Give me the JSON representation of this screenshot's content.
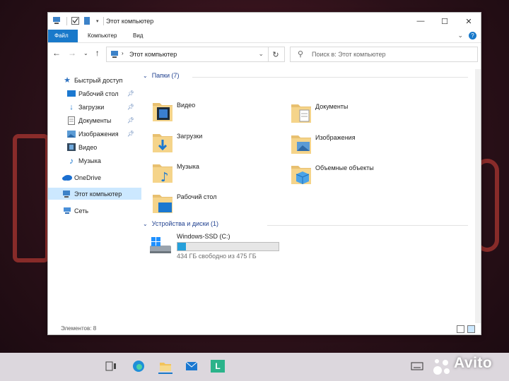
{
  "window": {
    "title": "Этот компьютер",
    "controls": {
      "minimize": "—",
      "maximize": "☐",
      "close": "✕"
    }
  },
  "ribbon": {
    "tabs": [
      "Файл",
      "Компьютер",
      "Вид"
    ],
    "expand_icon": "chevron-down-icon",
    "help_icon": "help-icon"
  },
  "address": {
    "path": "Этот компьютер",
    "search_placeholder": "Поиск в: Этот компьютер"
  },
  "sidebar": {
    "items": [
      {
        "label": "Быстрый доступ",
        "icon": "star-icon",
        "pinned": false
      },
      {
        "label": "Рабочий стол",
        "icon": "desktop-icon",
        "pinned": true
      },
      {
        "label": "Загрузки",
        "icon": "download-icon",
        "pinned": true
      },
      {
        "label": "Документы",
        "icon": "documents-icon",
        "pinned": true
      },
      {
        "label": "Изображения",
        "icon": "pictures-icon",
        "pinned": true
      },
      {
        "label": "Видео",
        "icon": "video-icon",
        "pinned": false
      },
      {
        "label": "Музыка",
        "icon": "music-icon",
        "pinned": false
      },
      {
        "label": "OneDrive",
        "icon": "cloud-icon",
        "pinned": false
      },
      {
        "label": "Этот компьютер",
        "icon": "computer-icon",
        "pinned": false,
        "selected": true
      },
      {
        "label": "Сеть",
        "icon": "network-icon",
        "pinned": false
      }
    ]
  },
  "content": {
    "folders_header": "Папки (7)",
    "folders": [
      {
        "label": "Видео",
        "icon": "video-folder-icon"
      },
      {
        "label": "Документы",
        "icon": "documents-folder-icon"
      },
      {
        "label": "Загрузки",
        "icon": "downloads-folder-icon"
      },
      {
        "label": "Изображения",
        "icon": "pictures-folder-icon"
      },
      {
        "label": "Музыка",
        "icon": "music-folder-icon"
      },
      {
        "label": "Объемные объекты",
        "icon": "3d-objects-folder-icon"
      },
      {
        "label": "Рабочий стол",
        "icon": "desktop-folder-icon"
      }
    ],
    "devices_header": "Устройства и диски (1)",
    "drive": {
      "name": "Windows-SSD (C:)",
      "free_text": "434 ГБ свободно из 475 ГБ",
      "used_fraction": 0.086
    }
  },
  "status": {
    "items": "Элементов: 8"
  },
  "taskbar": {
    "icons": [
      "task-view-icon",
      "edge-icon",
      "file-explorer-icon",
      "mail-icon",
      "app-l-icon"
    ],
    "app_l_letter": "L"
  },
  "watermark": "Avito",
  "colors": {
    "accent": "#1979ca",
    "selection": "#cce8ff",
    "drive_fill": "#26a0da",
    "group_header": "#1e3f8f"
  }
}
